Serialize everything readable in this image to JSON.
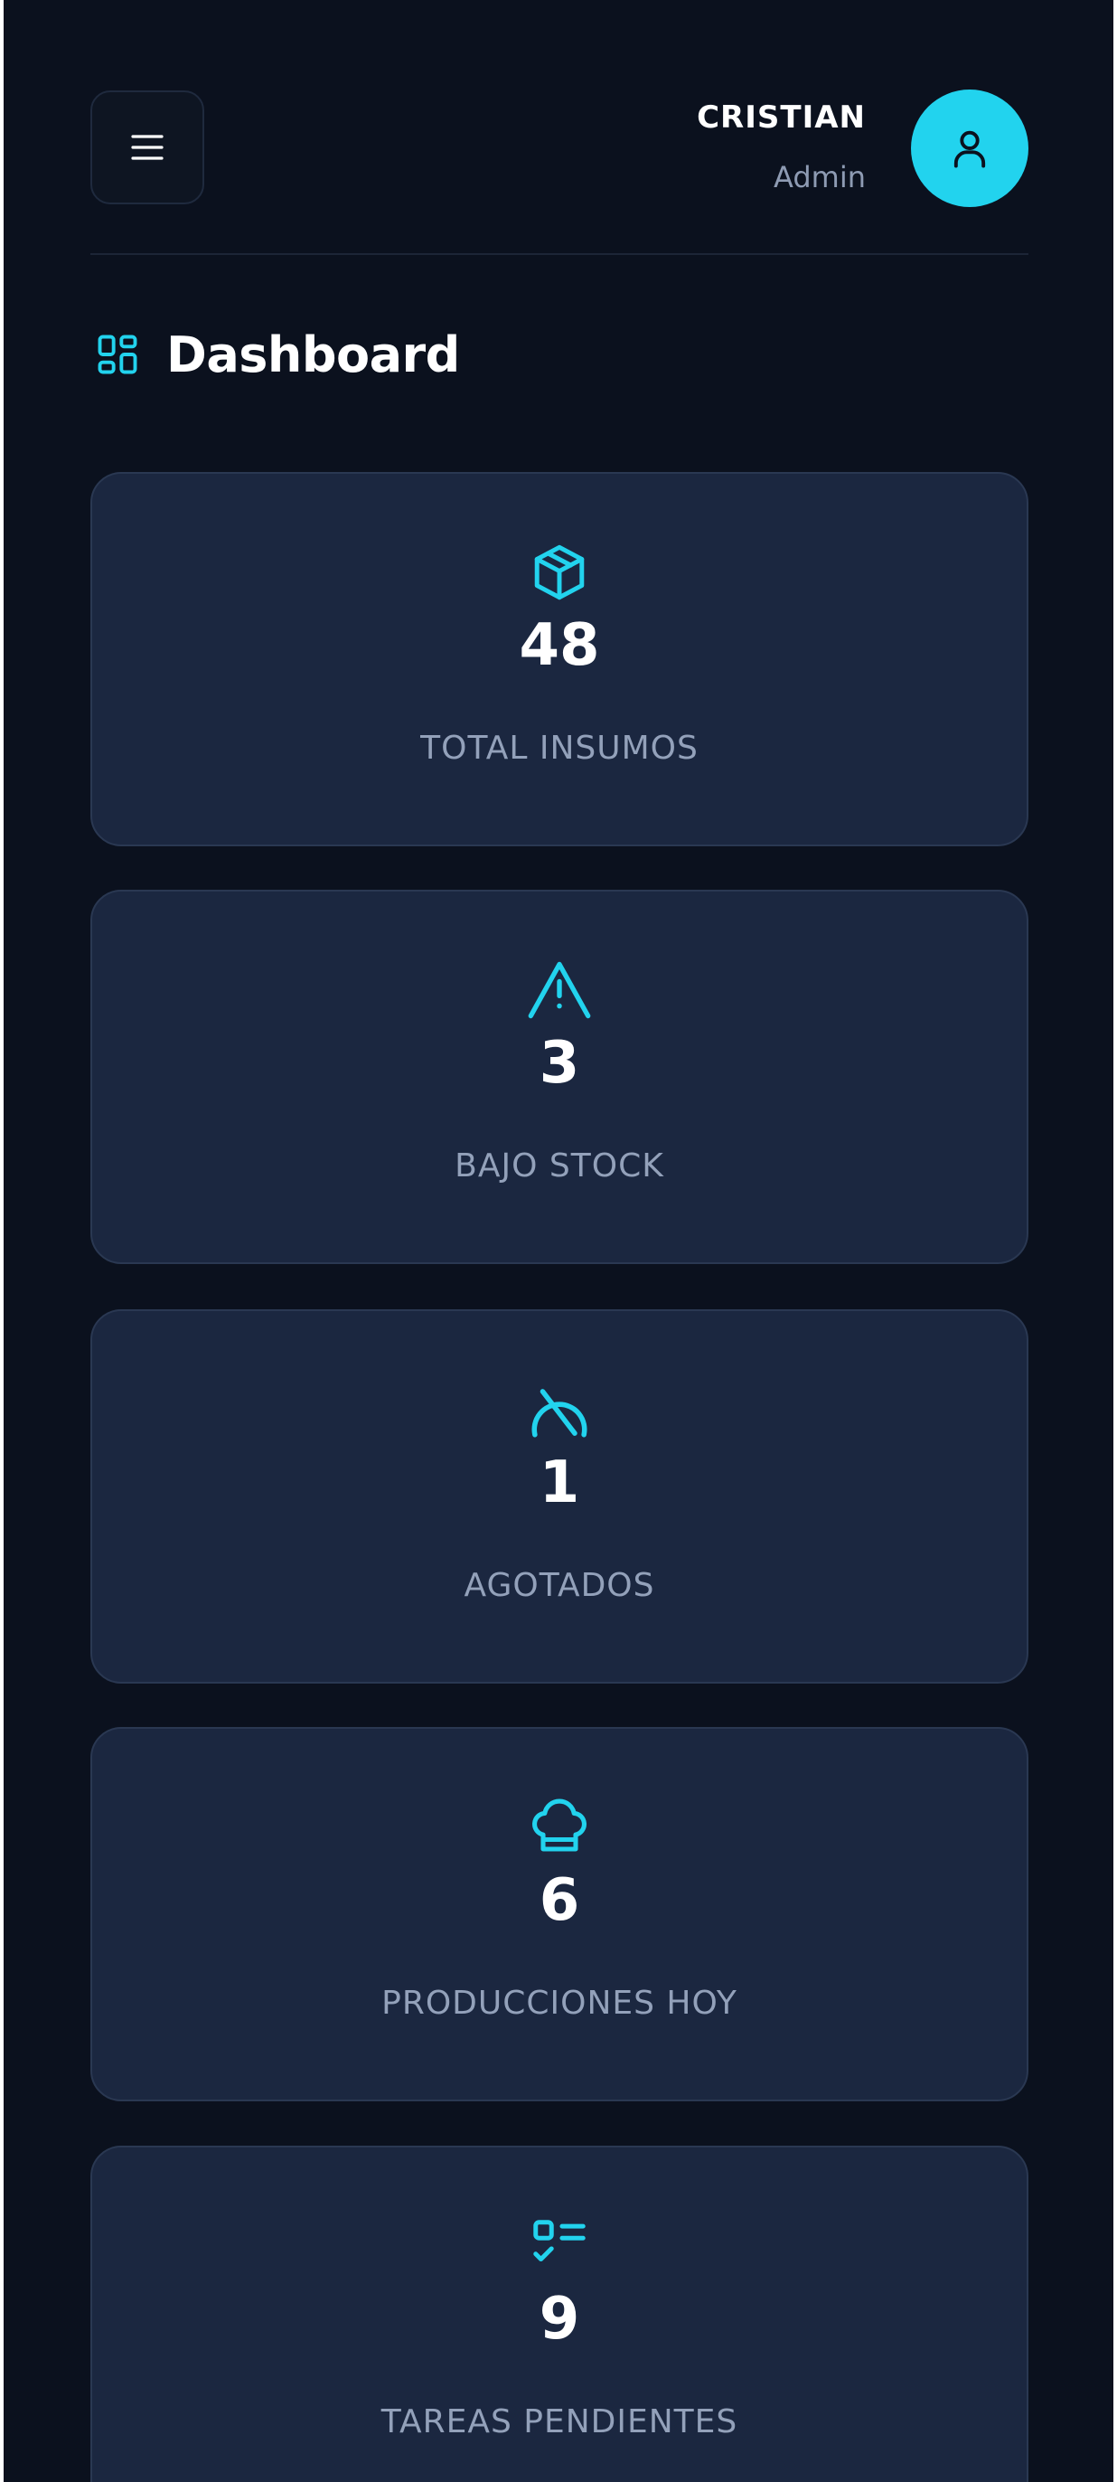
{
  "user": {
    "name": "CRISTIAN",
    "role": "Admin"
  },
  "page": {
    "title": "Dashboard"
  },
  "colors": {
    "background": "#0b111e",
    "card": "#1b2740",
    "accent": "#22d3ee",
    "label": "#93a1ba"
  },
  "stats": [
    {
      "icon": "package-icon",
      "value": "48",
      "label": "TOTAL INSUMOS"
    },
    {
      "icon": "warning-icon",
      "value": "3",
      "label": "BAJO STOCK"
    },
    {
      "icon": "ban-icon",
      "value": "1",
      "label": "AGOTADOS"
    },
    {
      "icon": "chef-hat-icon",
      "value": "6",
      "label": "PRODUCCIONES HOY"
    },
    {
      "icon": "task-list-icon",
      "value": "9",
      "label": "TAREAS PENDIENTES"
    }
  ]
}
